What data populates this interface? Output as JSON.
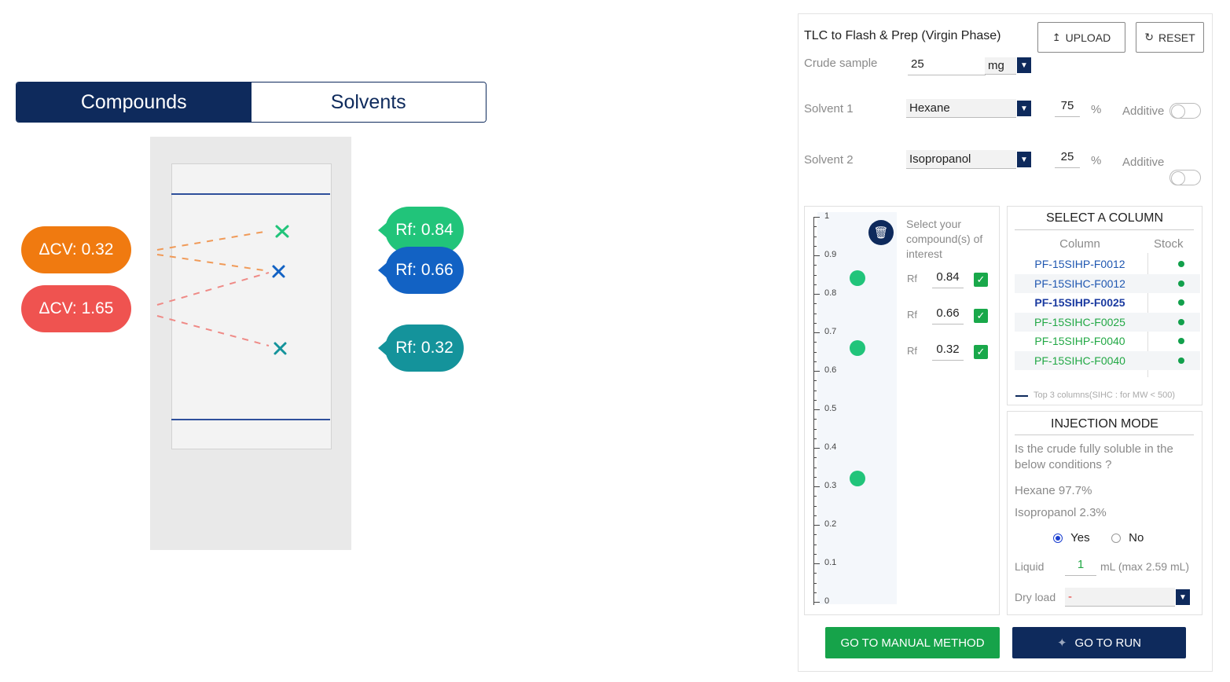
{
  "tabs": {
    "compounds": "Compounds",
    "solvents": "Solvents"
  },
  "tlc": {
    "delta_cv": [
      {
        "label": "ΔCV: 0.32",
        "color": "#f07a10"
      },
      {
        "label": "ΔCV: 1.65",
        "color": "#ef5350"
      }
    ],
    "rf_pills": [
      {
        "label": "Rf: 0.84",
        "color": "#21c47a"
      },
      {
        "label": "Rf: 0.66",
        "color": "#1262c4"
      },
      {
        "label": "Rf: 0.32",
        "color": "#14939b"
      }
    ]
  },
  "panel": {
    "title": "TLC to Flash & Prep (Virgin Phase)",
    "upload_label": "UPLOAD",
    "reset_label": "RESET",
    "crude_sample": {
      "label": "Crude sample",
      "value": "25",
      "unit": "mg"
    },
    "solvent1": {
      "label": "Solvent 1",
      "value": "Hexane",
      "percent": "75",
      "percent_sign": "%",
      "additive": "Additive"
    },
    "solvent2": {
      "label": "Solvent 2",
      "value": "Isopropanol",
      "percent": "25",
      "percent_sign": "%",
      "additive": "Additive"
    },
    "scale": {
      "ticks": [
        "1",
        "0.9",
        "0.8",
        "0.7",
        "0.6",
        "0.5",
        "0.4",
        "0.3",
        "0.2",
        "0.1",
        "0"
      ],
      "dots": [
        0.84,
        0.66,
        0.32
      ]
    },
    "compounds": {
      "title": "Select your compound(s) of interest",
      "rows": [
        {
          "prefix": "Rf",
          "value": "0.84",
          "check": "✓"
        },
        {
          "prefix": "Rf",
          "value": "0.66",
          "check": "✓"
        },
        {
          "prefix": "Rf",
          "value": "0.32",
          "check": "✓"
        }
      ]
    },
    "select_column": {
      "title": "SELECT A COLUMN",
      "col_header": "Column",
      "stock_header": "Stock",
      "rows": [
        {
          "name": "PF-15SIHP-F0012",
          "color": "#1e56b0"
        },
        {
          "name": "PF-15SIHC-F0012",
          "color": "#1e56b0"
        },
        {
          "name": "PF-15SIHP-F0025",
          "color": "#1a3aa0"
        },
        {
          "name": "PF-15SIHC-F0025",
          "color": "#22a845"
        },
        {
          "name": "PF-15SIHP-F0040",
          "color": "#22a845"
        },
        {
          "name": "PF-15SIHC-F0040",
          "color": "#22a845"
        }
      ],
      "footnote": "Top 3 columns(SIHC : for MW < 500)"
    },
    "injection": {
      "title": "INJECTION MODE",
      "question": "Is the crude fully soluble in the below conditions ?",
      "line1": "Hexane 97.7%",
      "line2": "Isopropanol 2.3%",
      "yes": "Yes",
      "no": "No",
      "liquid_label": "Liquid",
      "liquid_value": "1",
      "liquid_unit": "mL (max 2.59 mL)",
      "dry_label": "Dry load",
      "dry_value": "-"
    },
    "manual_btn": "GO TO MANUAL METHOD",
    "run_btn": "GO TO RUN"
  }
}
